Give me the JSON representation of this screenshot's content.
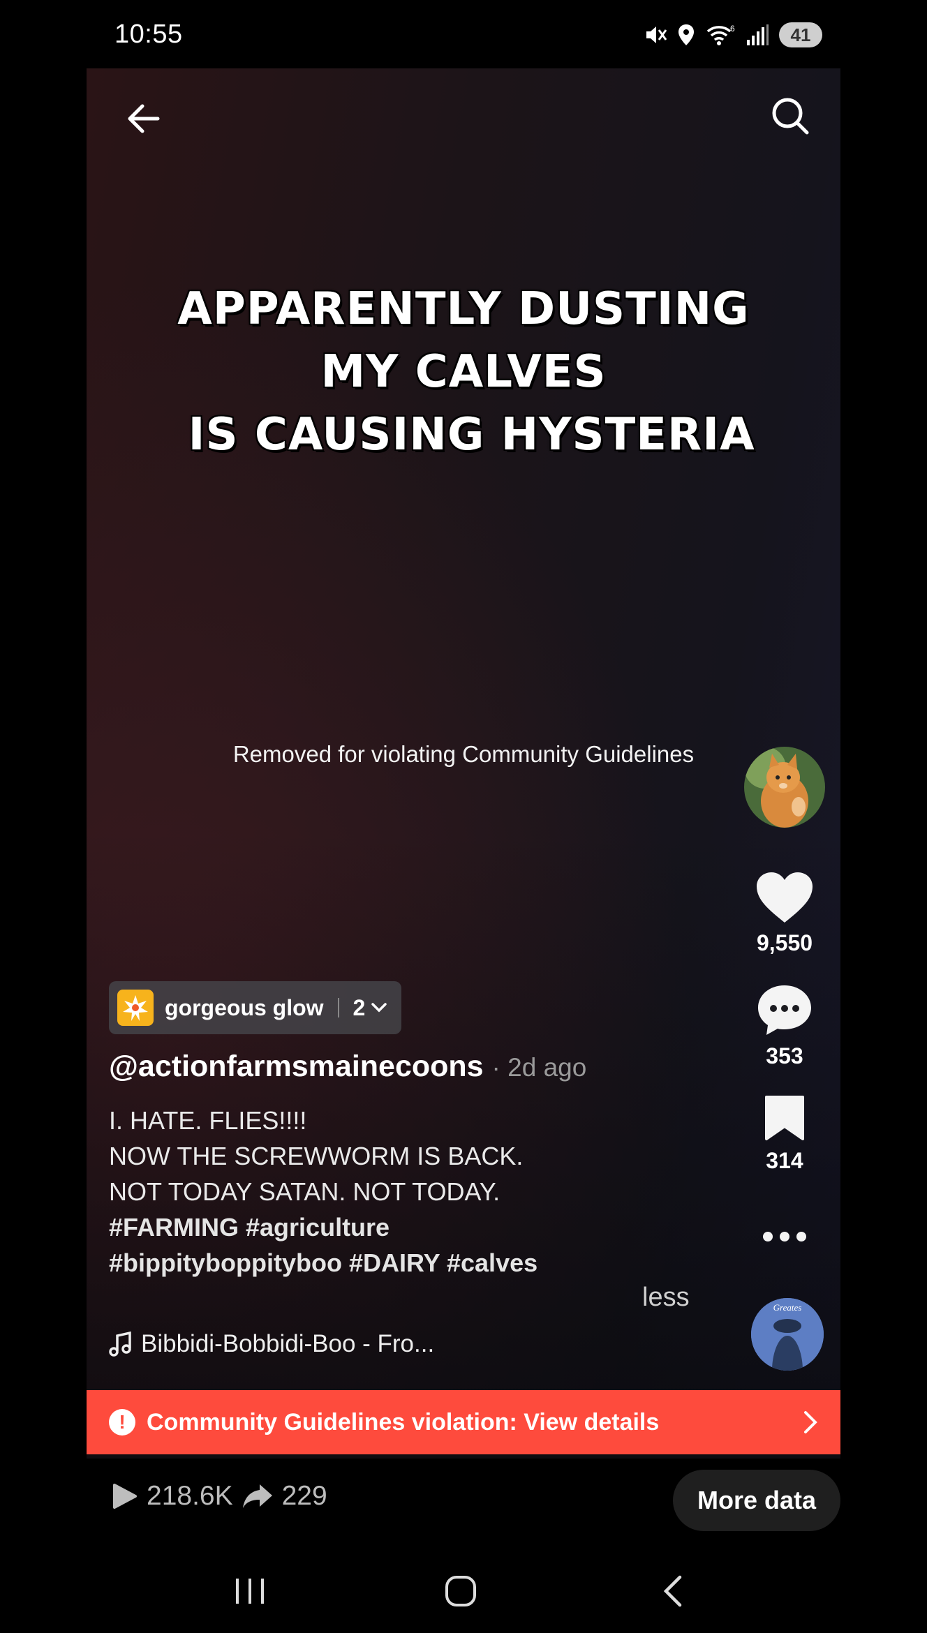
{
  "status_bar": {
    "time": "10:55",
    "battery_level": "41",
    "icons": [
      "mute-icon",
      "location-icon",
      "wifi-icon",
      "signal-icon",
      "battery-icon"
    ]
  },
  "video": {
    "overlay_lines": [
      "APPARENTLY DUSTING",
      "MY CALVES",
      " IS CAUSING HYSTERIA"
    ],
    "removed_notice": "Removed for violating Community Guidelines"
  },
  "actions": {
    "likes": "9,550",
    "comments": "353",
    "saves": "314"
  },
  "effect": {
    "name": "gorgeous glow",
    "count": "2"
  },
  "post": {
    "username": "@actionfarmsmainecoons",
    "time_ago": "· 2d ago",
    "caption_lines": [
      "I. HATE. FLIES!!!!",
      "NOW THE SCREWWORM IS BACK.",
      "NOT TODAY SATAN. NOT TODAY."
    ],
    "hashtag_line_1": "#FARMING #agriculture",
    "hashtag_line_2": "#bippityboppityboo #DAIRY #calves",
    "less_label": "less",
    "music": "Bibbidi-Bobbidi-Boo - Fro...",
    "disc_text": "Greates"
  },
  "violation_banner": {
    "text": "Community Guidelines violation: View details"
  },
  "stats": {
    "views": "218.6K",
    "shares": "229",
    "more_data_label": "More data"
  },
  "colors": {
    "violation_red": "#fe4b3d",
    "effect_yellow": "#f7b31c",
    "disc_blue": "#5d7ec4"
  }
}
